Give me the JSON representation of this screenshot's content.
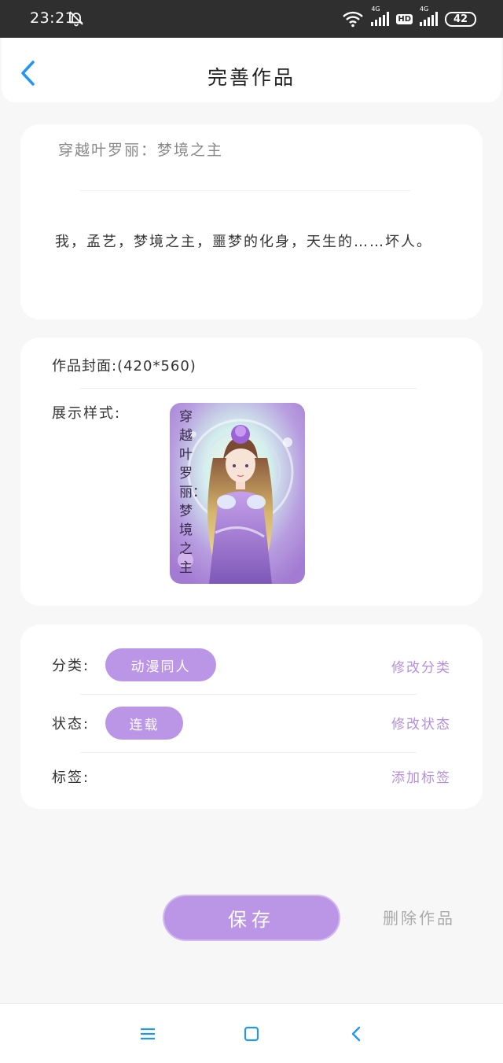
{
  "status_bar": {
    "time": "23:21",
    "network_1": "4G",
    "hd": "HD",
    "network_2": "4G",
    "battery": "42"
  },
  "header": {
    "title": "完善作品"
  },
  "work": {
    "title": "穿越叶罗丽：梦境之主",
    "description": "我，孟艺，梦境之主，噩梦的化身，天生的……坏人。"
  },
  "cover": {
    "label": "作品封面:(420*560)",
    "style_label": "展示样式:",
    "cover_text": "穿越叶罗丽：梦境之主"
  },
  "details": {
    "category_label": "分类:",
    "category_value": "动漫同人",
    "category_action": "修改分类",
    "status_label": "状态:",
    "status_value": "连载",
    "status_action": "修改状态",
    "tags_label": "标签:",
    "tags_action": "添加标签"
  },
  "actions": {
    "save": "保存",
    "delete": "删除作品"
  },
  "colors": {
    "accent": "#bb96e6",
    "link": "#b48ee0",
    "back_arrow": "#2196f3"
  },
  "icons": {
    "back": "chevron-left-icon",
    "menu": "menu-icon",
    "home": "square-icon",
    "nav_back": "chevron-left-icon"
  }
}
